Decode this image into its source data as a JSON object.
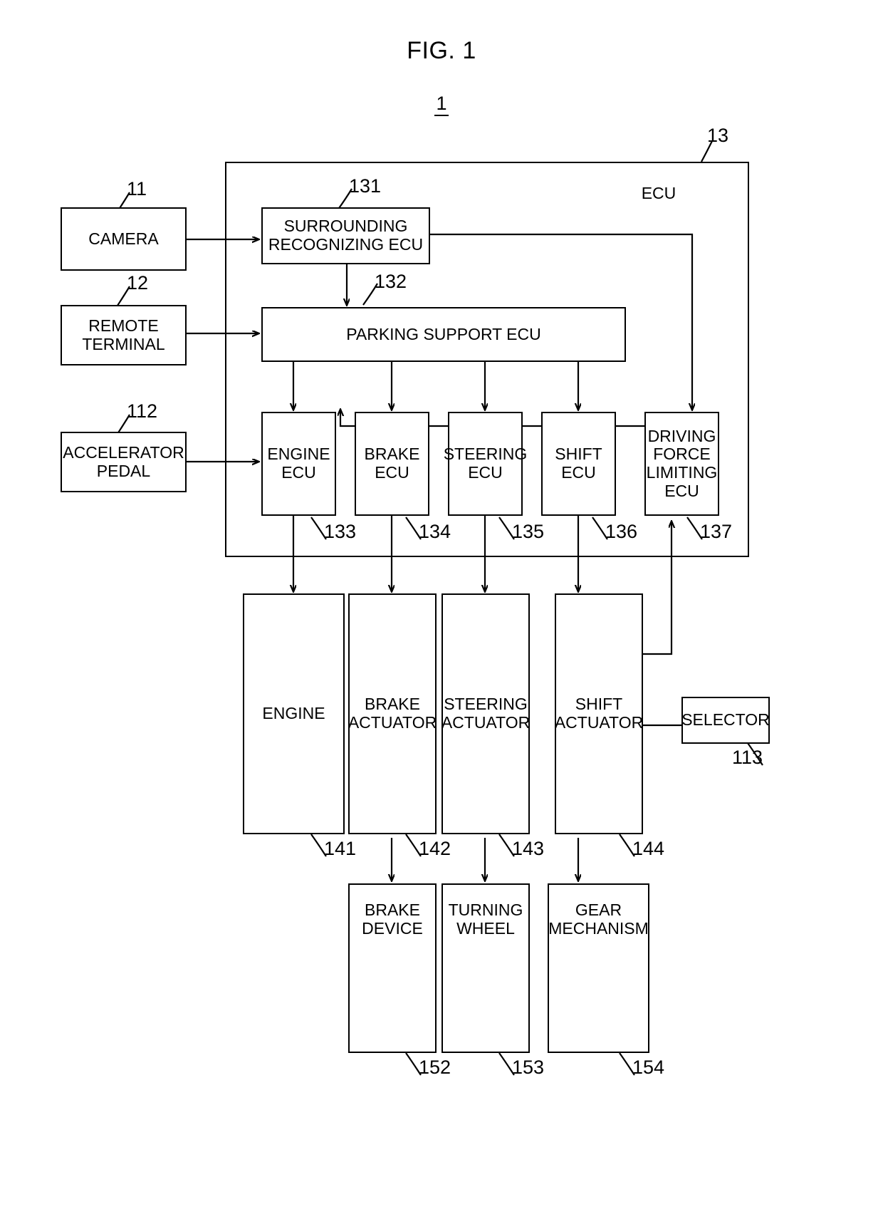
{
  "figure": {
    "title": "FIG. 1",
    "system_number": "1"
  },
  "ecu_group": {
    "label": "ECU",
    "ref": "13"
  },
  "inputs": [
    {
      "label": "CAMERA",
      "ref": "11"
    },
    {
      "label": "REMOTE\nTERMINAL",
      "ref": "12"
    },
    {
      "label": "ACCELERATOR\nPEDAL",
      "ref": "112"
    }
  ],
  "ecus": {
    "surrounding": {
      "label": "SURROUNDING\nRECOGNIZING ECU",
      "ref": "131"
    },
    "parking": {
      "label": "PARKING SUPPORT ECU",
      "ref": "132"
    },
    "row": [
      {
        "label": "ENGINE\nECU",
        "ref": "133"
      },
      {
        "label": "BRAKE\nECU",
        "ref": "134"
      },
      {
        "label": "STEERING\nECU",
        "ref": "135"
      },
      {
        "label": "SHIFT\nECU",
        "ref": "136"
      },
      {
        "label": "DRIVING\nFORCE\nLIMITING\nECU",
        "ref": "137"
      }
    ]
  },
  "actuators": [
    {
      "label": "ENGINE",
      "ref": "141"
    },
    {
      "label": "BRAKE\nACTUATOR",
      "ref": "142"
    },
    {
      "label": "STEERING\nACTUATOR",
      "ref": "143"
    },
    {
      "label": "SHIFT\nACTUATOR",
      "ref": "144"
    }
  ],
  "selector": {
    "label": "SELECTOR",
    "ref": "113"
  },
  "mechanisms": [
    {
      "label": "BRAKE\nDEVICE",
      "ref": "152"
    },
    {
      "label": "TURNING\nWHEEL",
      "ref": "153"
    },
    {
      "label": "GEAR\nMECHANISM",
      "ref": "154"
    }
  ],
  "colors": {
    "stroke": "#000000",
    "background": "#ffffff"
  }
}
